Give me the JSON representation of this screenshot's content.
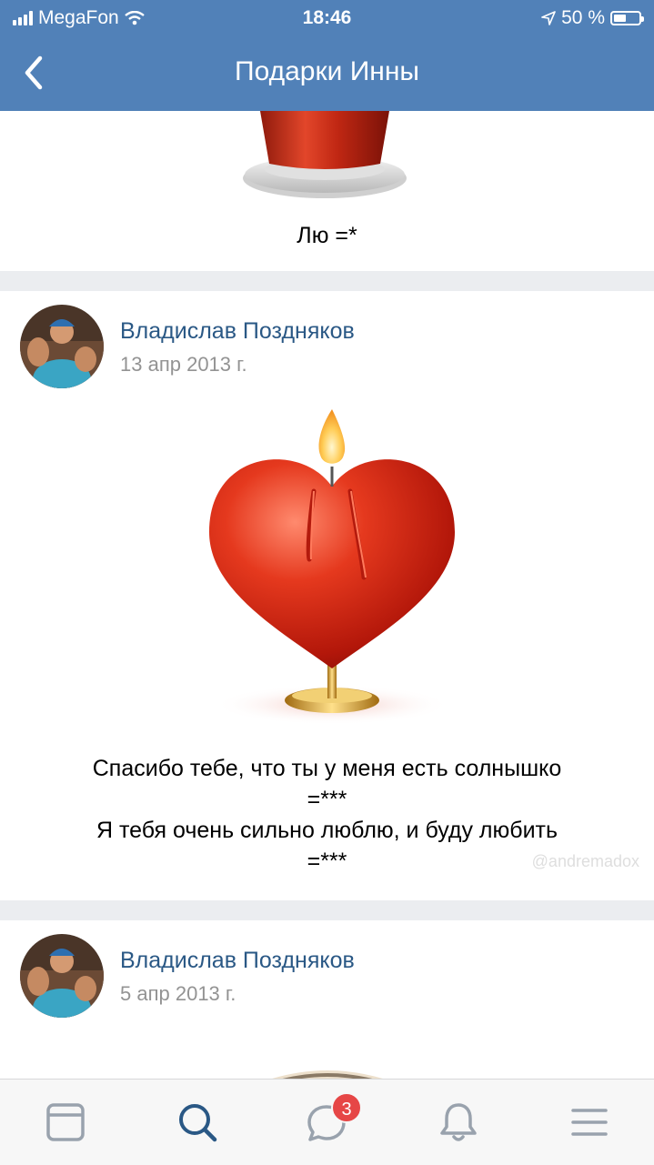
{
  "status_bar": {
    "carrier": "MegaFon",
    "time": "18:46",
    "battery": "50 %",
    "battery_level": 0.5
  },
  "navbar": {
    "title": "Подарки Инны",
    "back_icon": "chevron-left-icon"
  },
  "gifts": [
    {
      "image": "red-pot-gift",
      "message": "Лю =*"
    },
    {
      "author": "Владислав Поздняков",
      "date": "13 апр 2013 г.",
      "image": "heart-candle-gift",
      "message": "Спасибо тебе, что ты у меня есть солнышко\n=***\nЯ тебя очень сильно люблю, и буду любить\n=***"
    },
    {
      "author": "Владислав Поздняков",
      "date": "5 апр 2013 г.",
      "image": "partial-gift"
    }
  ],
  "watermark": "@andremadox",
  "tab_bar": {
    "items": [
      {
        "name": "news",
        "icon": "news-feed-icon"
      },
      {
        "name": "search",
        "icon": "search-icon",
        "active": true
      },
      {
        "name": "messages",
        "icon": "messages-icon"
      },
      {
        "name": "notifications",
        "icon": "bell-icon"
      },
      {
        "name": "menu",
        "icon": "menu-icon"
      }
    ],
    "messages_badge": "3"
  },
  "colors": {
    "header": "#5181b8",
    "link": "#2a5885",
    "badge": "#e64646",
    "active_tab": "#2a5885",
    "inactive_tab": "#99a2ad"
  }
}
